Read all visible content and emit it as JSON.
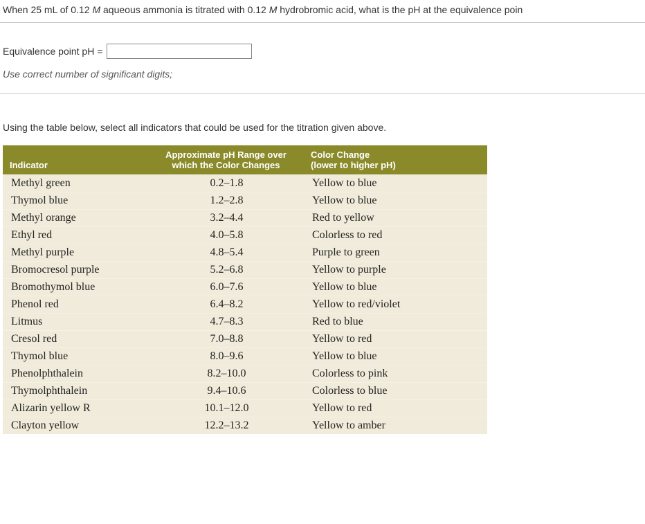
{
  "question": {
    "text_before": "When 25 mL of 0.12 ",
    "m1": "M",
    "text_mid": " aqueous ammonia is titrated with 0.12 ",
    "m2": "M",
    "text_after": " hydrobromic acid, what is the pH at the equivalence poin"
  },
  "answer": {
    "label": "Equivalence point pH =",
    "value": "",
    "hint": "Use correct number of significant digits;"
  },
  "instructions": "Using the table below, select all indicators that could be used for the titration given above.",
  "table": {
    "headers": {
      "indicator": "Indicator",
      "range_line1": "Approximate pH Range over",
      "range_line2": "which the Color Changes",
      "change_line1": "Color Change",
      "change_line2": "(lower to higher pH)"
    },
    "rows": [
      {
        "indicator": "Methyl green",
        "range": "0.2–1.8",
        "change": "Yellow to blue"
      },
      {
        "indicator": "Thymol blue",
        "range": "1.2–2.8",
        "change": "Yellow to blue"
      },
      {
        "indicator": "Methyl orange",
        "range": "3.2–4.4",
        "change": "Red to yellow"
      },
      {
        "indicator": "Ethyl red",
        "range": "4.0–5.8",
        "change": "Colorless to red"
      },
      {
        "indicator": "Methyl purple",
        "range": "4.8–5.4",
        "change": "Purple to green"
      },
      {
        "indicator": "Bromocresol purple",
        "range": "5.2–6.8",
        "change": "Yellow to purple"
      },
      {
        "indicator": "Bromothymol blue",
        "range": "6.0–7.6",
        "change": "Yellow to blue"
      },
      {
        "indicator": "Phenol red",
        "range": "6.4–8.2",
        "change": "Yellow to red/violet"
      },
      {
        "indicator": "Litmus",
        "range": "4.7–8.3",
        "change": "Red to blue"
      },
      {
        "indicator": "Cresol red",
        "range": "7.0–8.8",
        "change": "Yellow to red"
      },
      {
        "indicator": "Thymol blue",
        "range": "8.0–9.6",
        "change": "Yellow to blue"
      },
      {
        "indicator": "Phenolphthalein",
        "range": "8.2–10.0",
        "change": "Colorless to pink"
      },
      {
        "indicator": "Thymolphthalein",
        "range": "9.4–10.6",
        "change": "Colorless to blue"
      },
      {
        "indicator": "Alizarin yellow R",
        "range": "10.1–12.0",
        "change": "Yellow to red"
      },
      {
        "indicator": "Clayton yellow",
        "range": "12.2–13.2",
        "change": "Yellow to amber"
      }
    ]
  }
}
